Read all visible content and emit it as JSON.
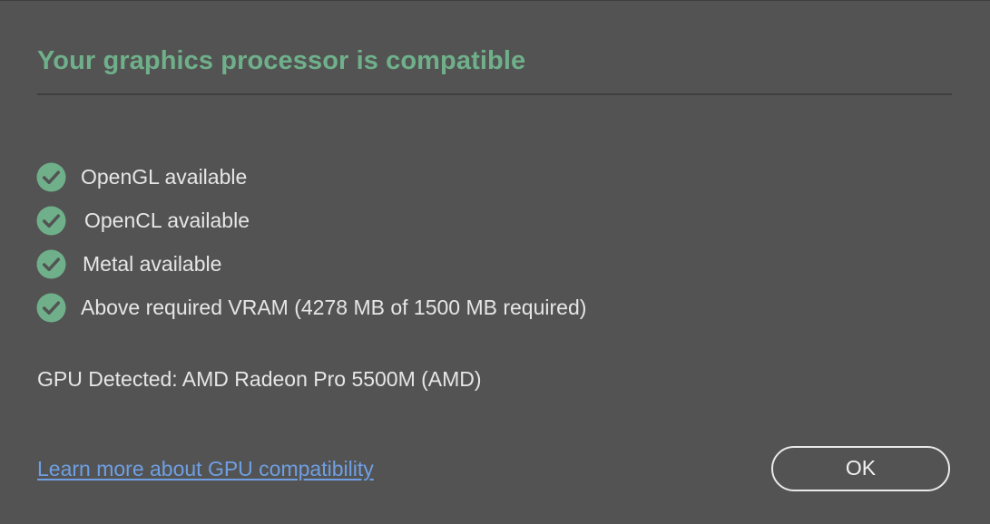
{
  "dialog": {
    "title": "Your graphics processor is compatible",
    "title_color": "#6fb08a",
    "checks": [
      {
        "label": "OpenGL available",
        "icon": "check-circle-icon"
      },
      {
        "label": "OpenCL available",
        "icon": "check-circle-icon"
      },
      {
        "label": "Metal available",
        "icon": "check-circle-icon"
      },
      {
        "label": "Above required VRAM (4278 MB of 1500 MB required)",
        "icon": "check-circle-icon"
      }
    ],
    "check_color": "#6fb08a",
    "gpu_detected": "GPU Detected: AMD Radeon Pro 5500M (AMD)",
    "learn_more_link": "Learn more about GPU compatibility",
    "link_color": "#6f9fe2",
    "ok_label": "OK",
    "background_color": "#535353"
  }
}
